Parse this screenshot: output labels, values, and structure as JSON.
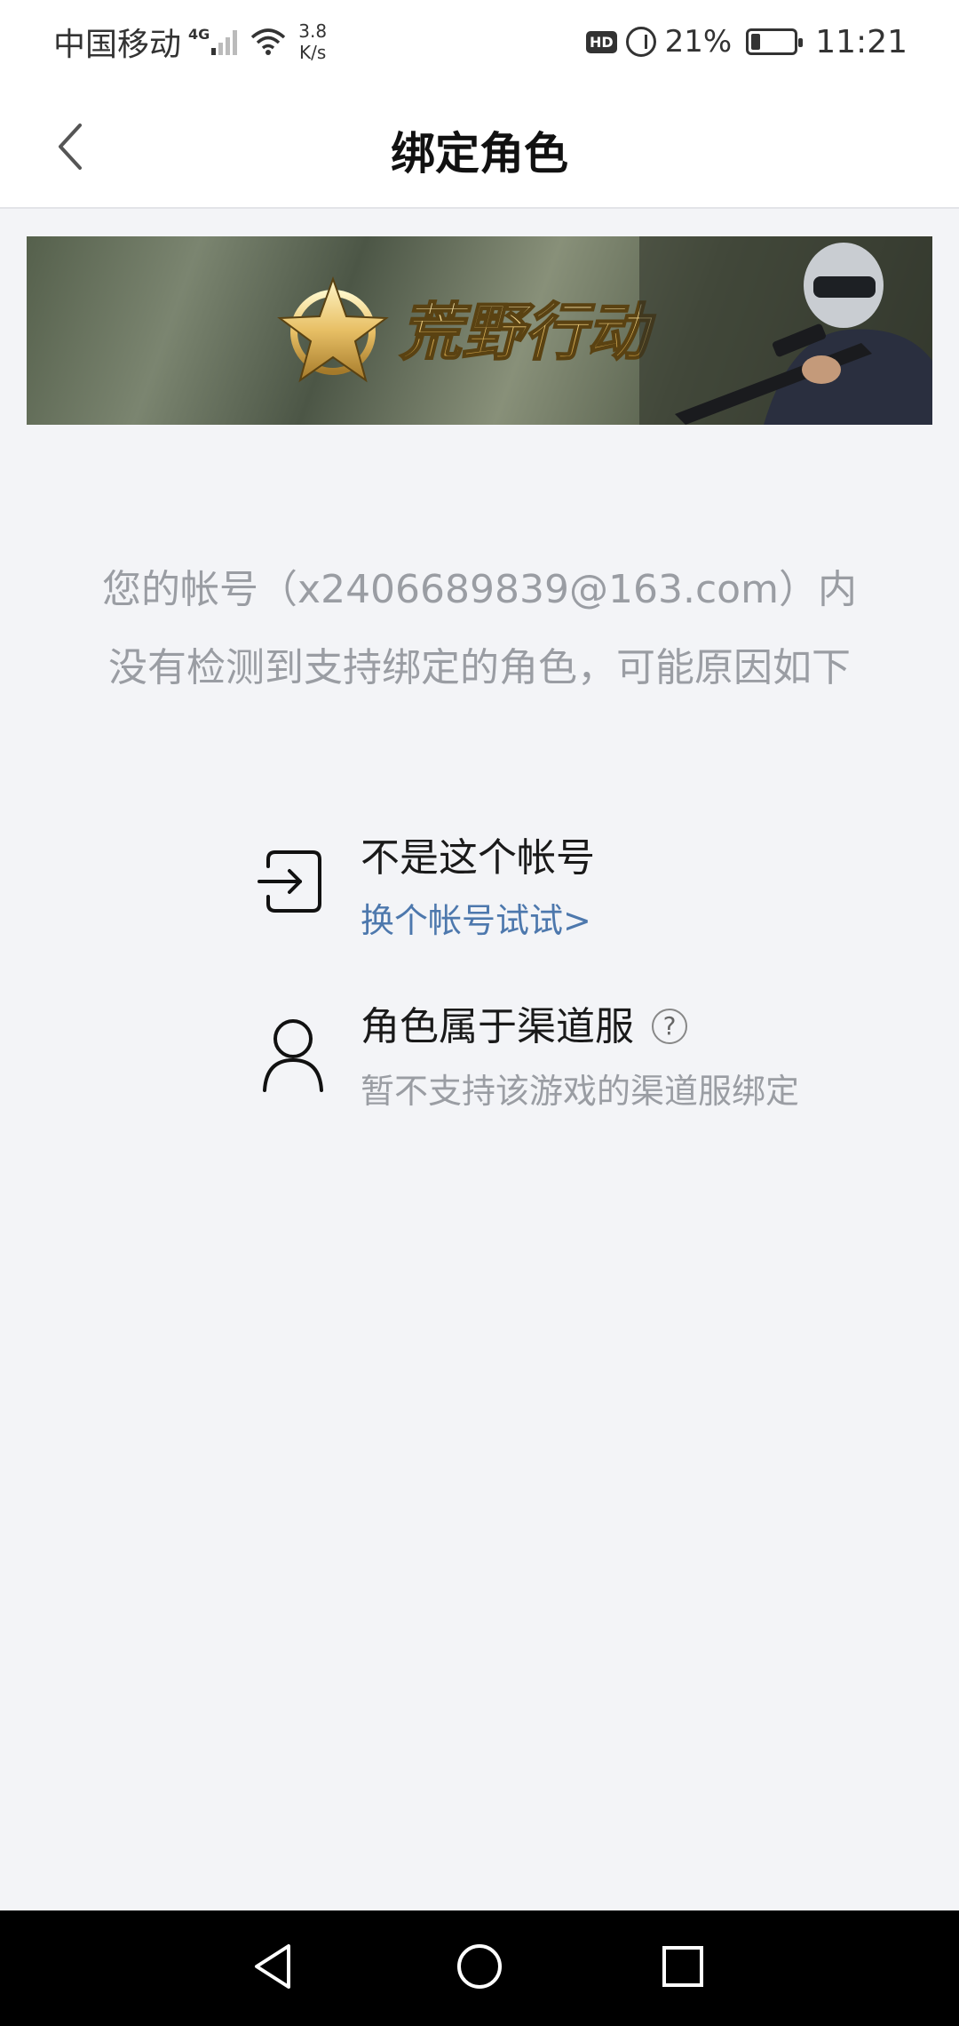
{
  "status_bar": {
    "carrier": "中国移动",
    "network_type": "4G",
    "speed_value": "3.8",
    "speed_unit": "K/s",
    "hd_badge": "HD",
    "battery_percent": "21%",
    "battery_level": 0.21,
    "time": "11:21"
  },
  "nav": {
    "back_icon": "chevron-left-icon",
    "title": "绑定角色"
  },
  "banner": {
    "game_name": "荒野行动"
  },
  "message": {
    "prefix": "您的帐号（",
    "account": "x2406689839@163.com",
    "suffix": "）内没有检测到支持绑定的角色，可能原因如下"
  },
  "reasons": [
    {
      "icon": "sign-in-icon",
      "title": "不是这个帐号",
      "link": "换个帐号试试>"
    },
    {
      "icon": "user-icon",
      "title": "角色属于渠道服",
      "help_icon": "?",
      "description": "暂不支持该游戏的渠道服绑定"
    }
  ],
  "system_nav": {
    "back": "triangle-back-icon",
    "home": "circle-home-icon",
    "recents": "square-recents-icon"
  },
  "colors": {
    "background": "#f3f4f7",
    "link": "#4d78ad",
    "muted_text": "#9a9da3"
  }
}
